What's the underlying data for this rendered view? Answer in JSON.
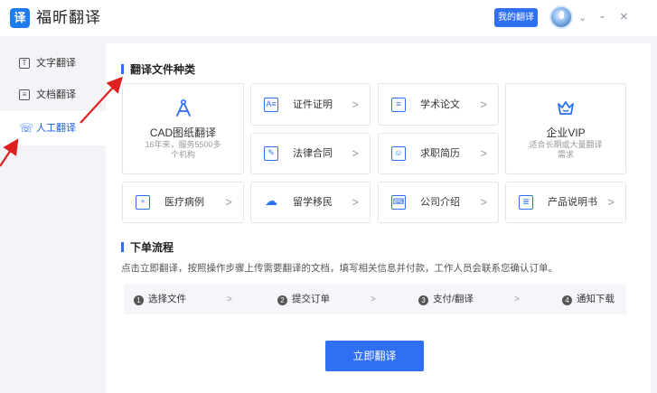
{
  "app": {
    "logo_char": "译",
    "title": "福昕翻译"
  },
  "header": {
    "my_translations": "我的翻译",
    "minimize": "-",
    "close": "×",
    "dropdown": "⌄"
  },
  "sidebar": {
    "items": [
      {
        "label": "文字翻译",
        "icon": "T"
      },
      {
        "label": "文档翻译",
        "icon": "≡"
      },
      {
        "label": "人工翻译",
        "icon": "☏",
        "active": true
      }
    ]
  },
  "categories": {
    "title": "翻译文件种类",
    "big_cards": [
      {
        "title": "CAD图纸翻译",
        "subtitle": "16年来，服务5500多个机构",
        "icon": "compass-icon"
      },
      {
        "title": "企业VIP",
        "subtitle": "适合长期或大量翻译需求",
        "icon": "crown-icon"
      }
    ],
    "cards": [
      {
        "label": "证件证明",
        "icon": "id-card-icon"
      },
      {
        "label": "学术论文",
        "icon": "document-icon"
      },
      {
        "label": "法律合同",
        "icon": "contract-icon"
      },
      {
        "label": "求职简历",
        "icon": "resume-icon"
      },
      {
        "label": "医疗病例",
        "icon": "medical-icon"
      },
      {
        "label": "留学移民",
        "icon": "cloud-icon"
      },
      {
        "label": "公司介绍",
        "icon": "keyboard-icon"
      },
      {
        "label": "产品说明书",
        "icon": "manual-icon"
      }
    ],
    "chevron": ">"
  },
  "process": {
    "title": "下单流程",
    "description": "点击立即翻译，按照操作步骤上传需要翻译的文档，填写相关信息并付款，工作人员会联系您确认订单。",
    "steps": [
      {
        "num": "1",
        "label": "选择文件"
      },
      {
        "num": "2",
        "label": "提交订单"
      },
      {
        "num": "3",
        "label": "支付/翻译"
      },
      {
        "num": "4",
        "label": "通知下载"
      }
    ],
    "arrow": ">"
  },
  "cta": {
    "label": "立即翻译"
  },
  "colors": {
    "accent": "#2f6ff2",
    "annotation": "#e02020"
  }
}
